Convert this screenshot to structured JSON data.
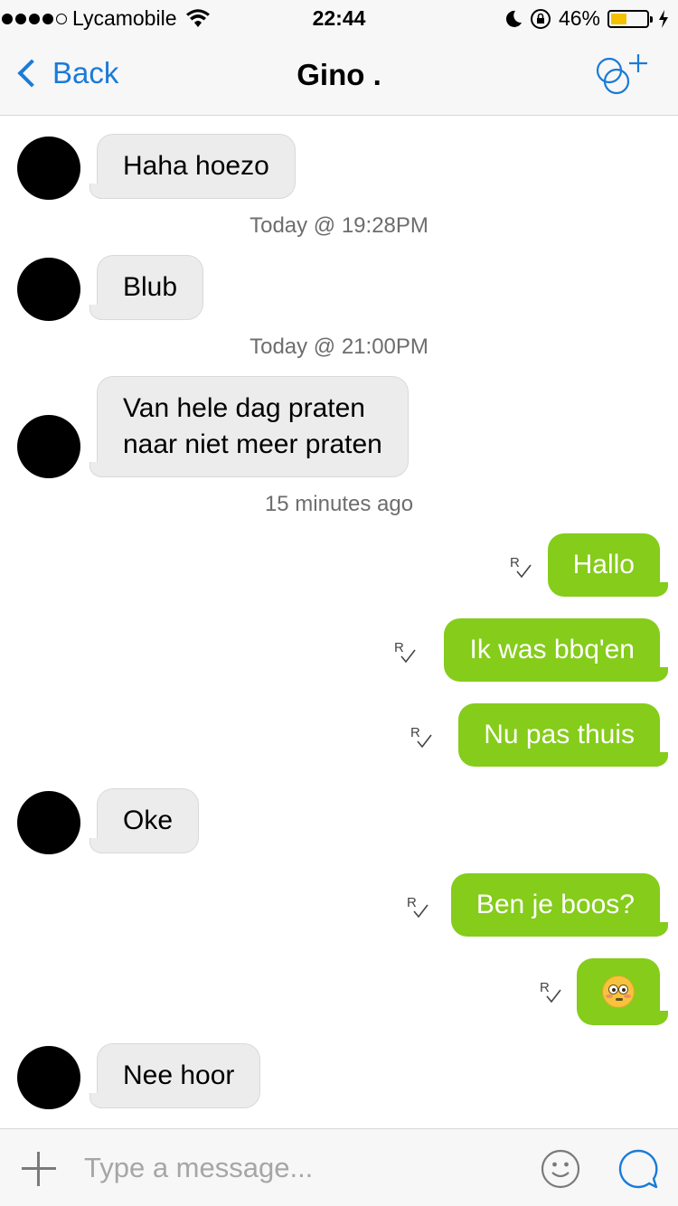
{
  "status_bar": {
    "carrier": "Lycamobile",
    "time": "22:44",
    "battery_percent_label": "46%",
    "battery_level": 0.46
  },
  "nav": {
    "back_label": "Back",
    "title": "Gino ."
  },
  "messages": [
    {
      "direction": "in",
      "text": "Haha hoezo"
    },
    {
      "direction": "in",
      "text": "Blub"
    },
    {
      "direction": "in",
      "lines": [
        "Van hele dag praten",
        "naar niet meer praten"
      ]
    },
    {
      "direction": "out",
      "text": "Hallo",
      "read_receipt": "R"
    },
    {
      "direction": "out",
      "text": "Ik was bbq'en",
      "read_receipt": "R"
    },
    {
      "direction": "out",
      "text": "Nu pas thuis",
      "read_receipt": "R"
    },
    {
      "direction": "in",
      "text": "Oke"
    },
    {
      "direction": "out",
      "text": "Ben je boos?",
      "read_receipt": "R"
    },
    {
      "direction": "out",
      "emoji": "flushed-face-emoji",
      "read_receipt": "R"
    },
    {
      "direction": "in",
      "text": "Nee hoor"
    }
  ],
  "timestamps": [
    "Today @ 19:28PM",
    "Today @ 21:00PM",
    "15 minutes ago"
  ],
  "input": {
    "placeholder": "Type a message..."
  },
  "colors": {
    "accent": "#1a7bd8",
    "outgoing_bubble": "#85cc1b",
    "incoming_bubble": "#ececec",
    "battery_fill": "#f4c100"
  },
  "icons": {
    "back": "chevron-left-icon",
    "add_contact": "add-contact-icon",
    "plus": "plus-icon",
    "emoji": "smiley-icon",
    "send": "chat-bubble-icon",
    "read": "read-receipt-icon"
  }
}
